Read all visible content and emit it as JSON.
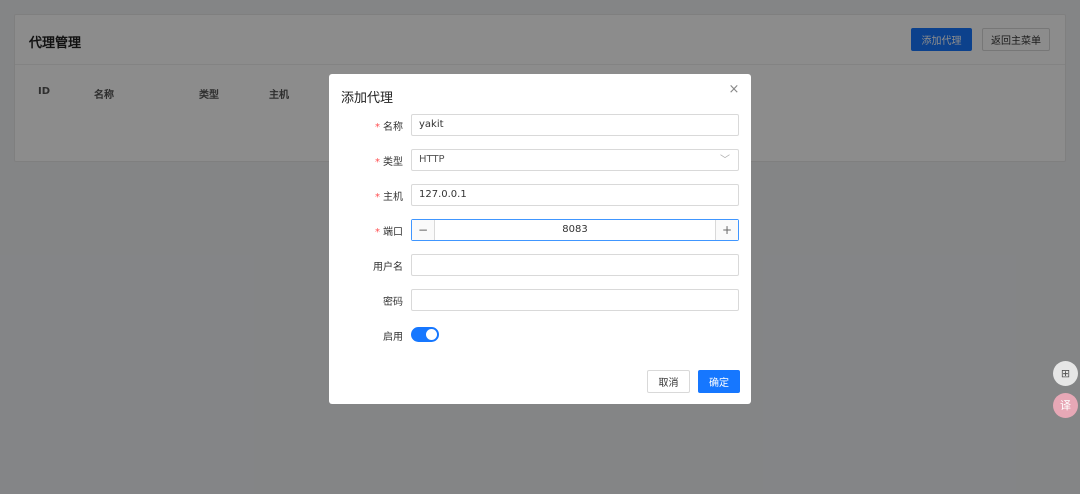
{
  "page": {
    "title": "代理管理",
    "add_button": "添加代理",
    "back_button": "返回主菜单",
    "columns": [
      "ID",
      "名称",
      "类型",
      "主机"
    ]
  },
  "modal": {
    "title": "添加代理",
    "close_icon": "×",
    "fields": {
      "name": {
        "label": "名称",
        "required": true,
        "value": "yakit"
      },
      "type": {
        "label": "类型",
        "required": true,
        "value": "HTTP",
        "arrow": "﹀"
      },
      "host": {
        "label": "主机",
        "required": true,
        "value": "127.0.0.1"
      },
      "port": {
        "label": "端口",
        "required": true,
        "value": "8083",
        "minus": "−",
        "plus": "+"
      },
      "username": {
        "label": "用户名",
        "value": ""
      },
      "password": {
        "label": "密码",
        "value": ""
      },
      "enabled": {
        "label": "启用",
        "on": true
      }
    },
    "required_mark": "*",
    "cancel_button": "取消",
    "ok_button": "确定"
  },
  "floating": {
    "apps_icon": "⊞",
    "translate_icon": "译"
  },
  "colors": {
    "primary": "#1677ff",
    "required": "#ff4d4f"
  }
}
